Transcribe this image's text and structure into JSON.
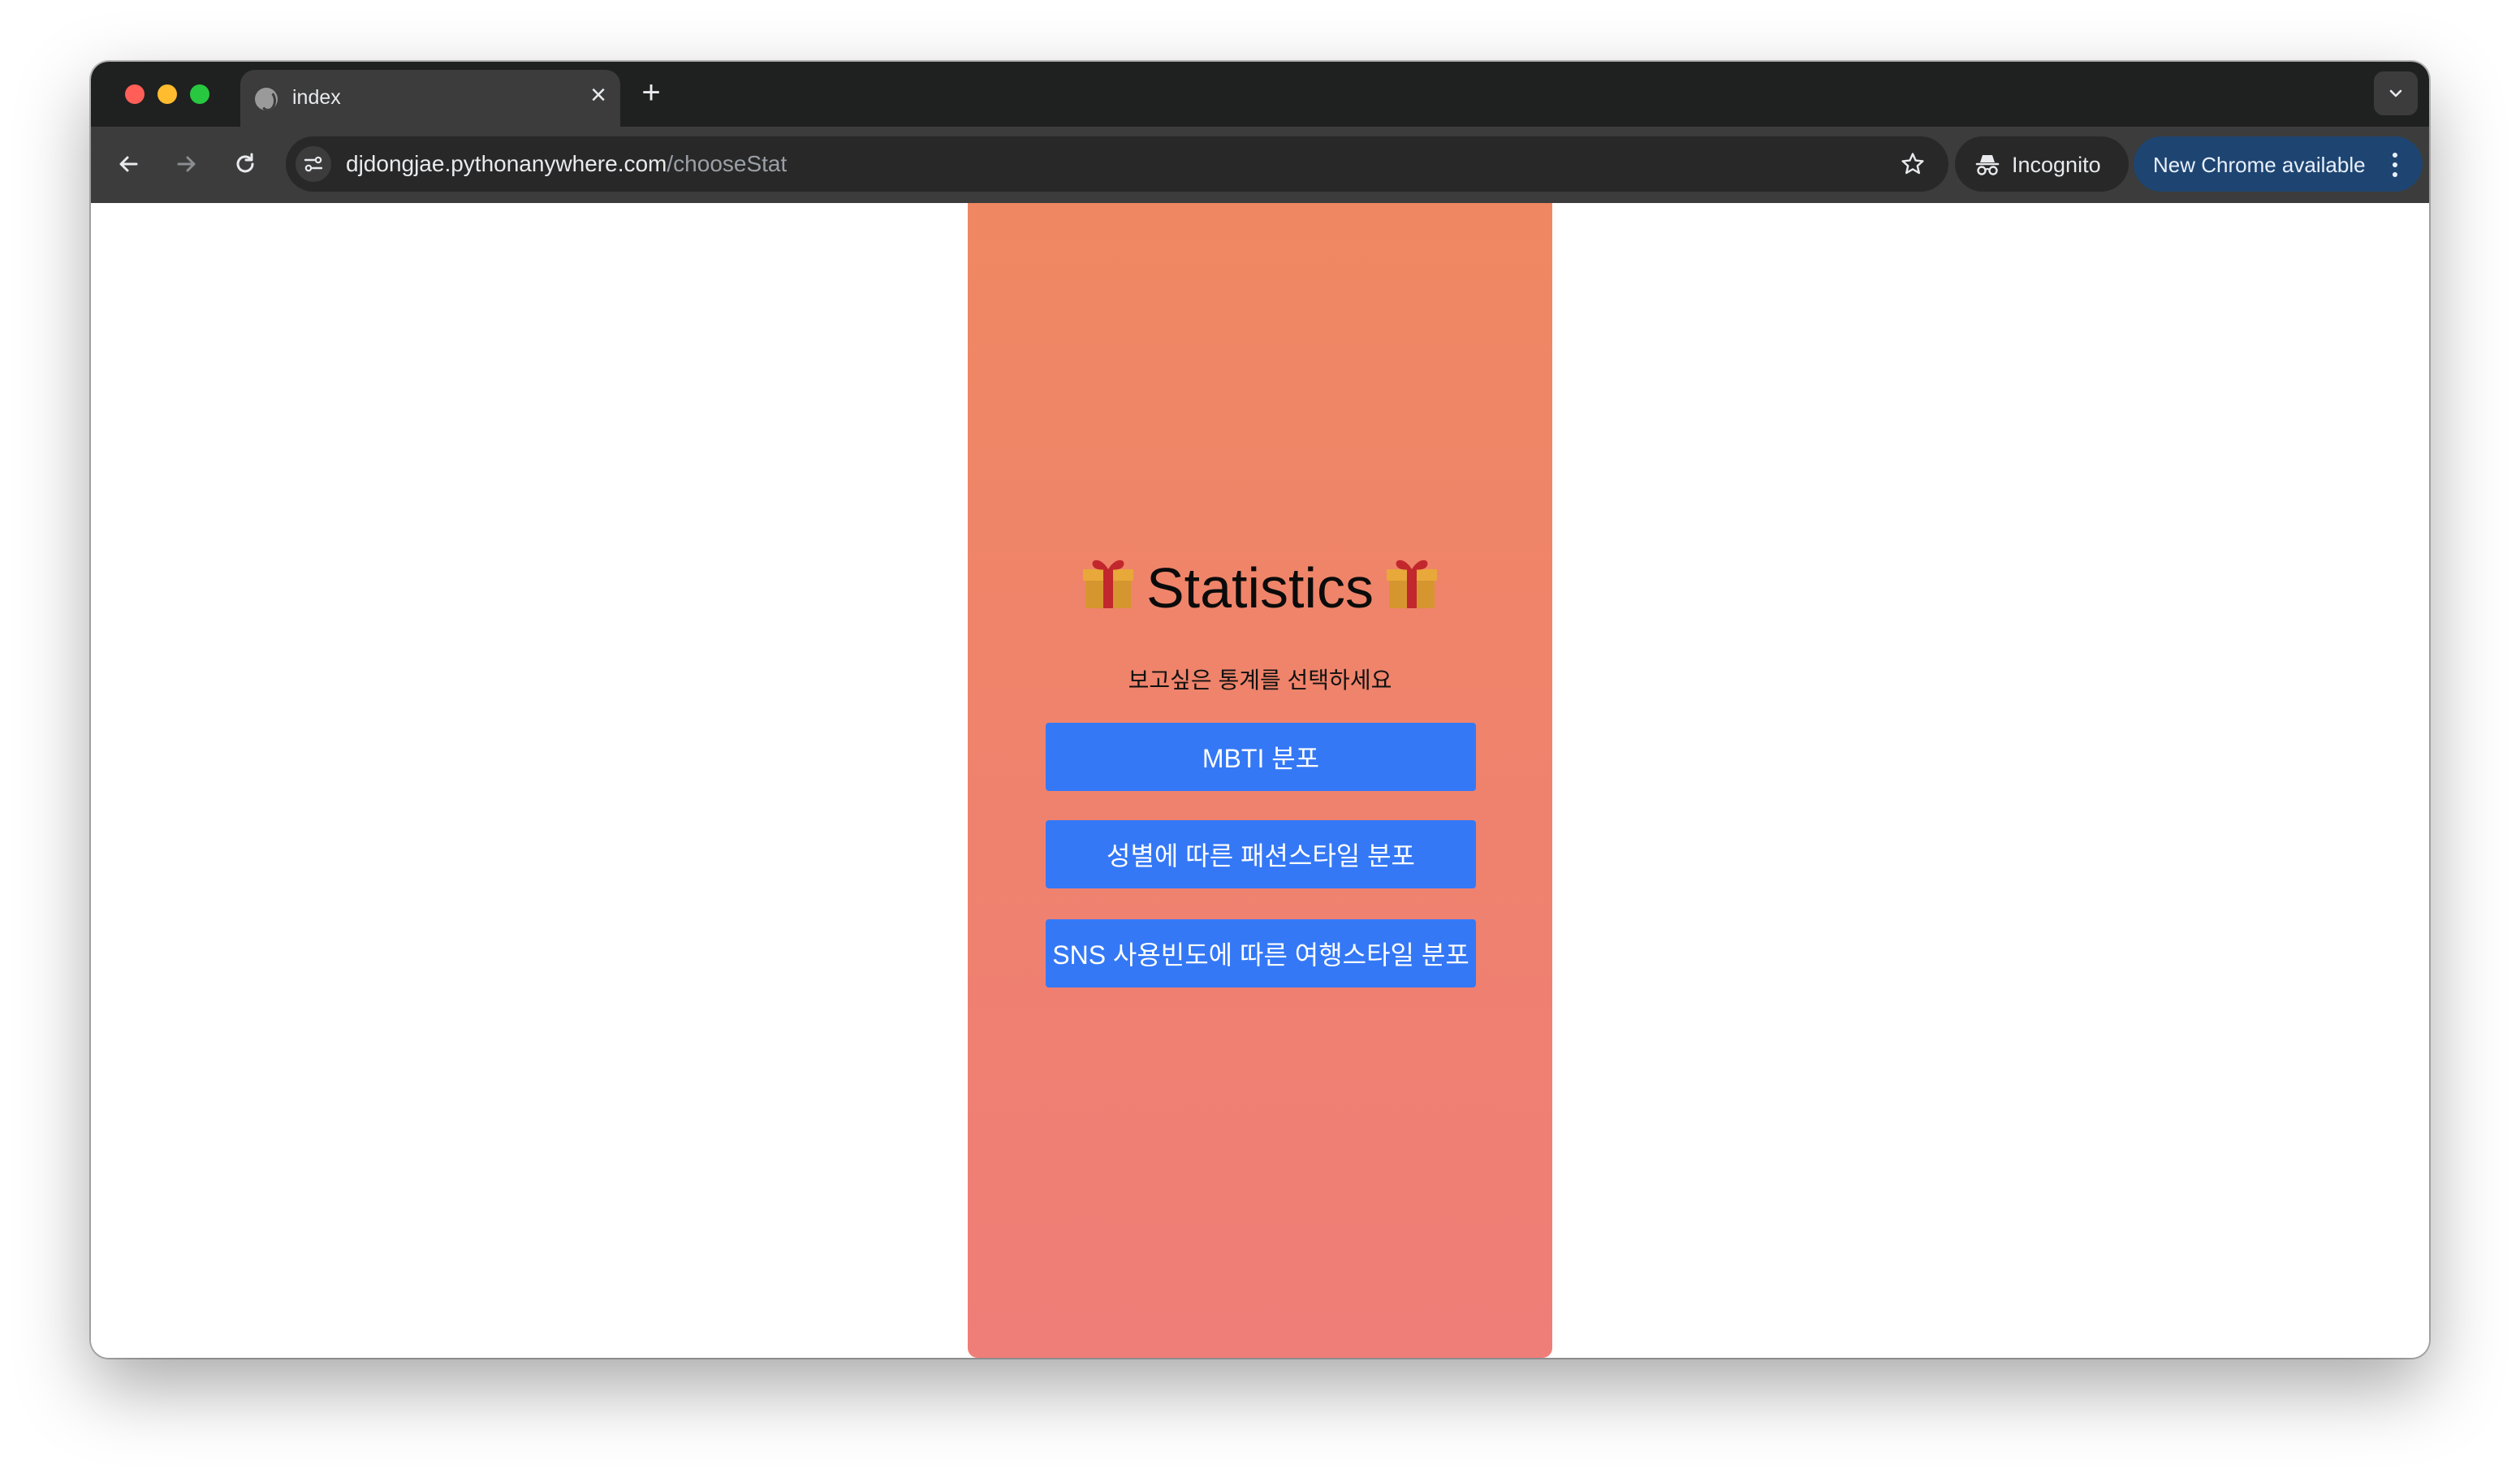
{
  "browser": {
    "tab": {
      "title": "index"
    },
    "url": {
      "domain": "djdongjae.pythonanywhere.com",
      "path": "/chooseStat"
    },
    "incognito_label": "Incognito",
    "update_label": "New Chrome available"
  },
  "page": {
    "heading": "Statistics",
    "heading_emoji": "gift-icon",
    "subtitle": "보고싶은 통계를 선택하세요",
    "buttons": [
      {
        "label": "MBTI 분포"
      },
      {
        "label": "성별에 따른 패션스타일 분포"
      },
      {
        "label": "SNS 사용빈도에 따른 여행스타일 분포"
      }
    ],
    "colors": {
      "card_gradient_top": "#ef8862",
      "card_gradient_bottom": "#ef7d78",
      "button": "#3478f6"
    }
  }
}
